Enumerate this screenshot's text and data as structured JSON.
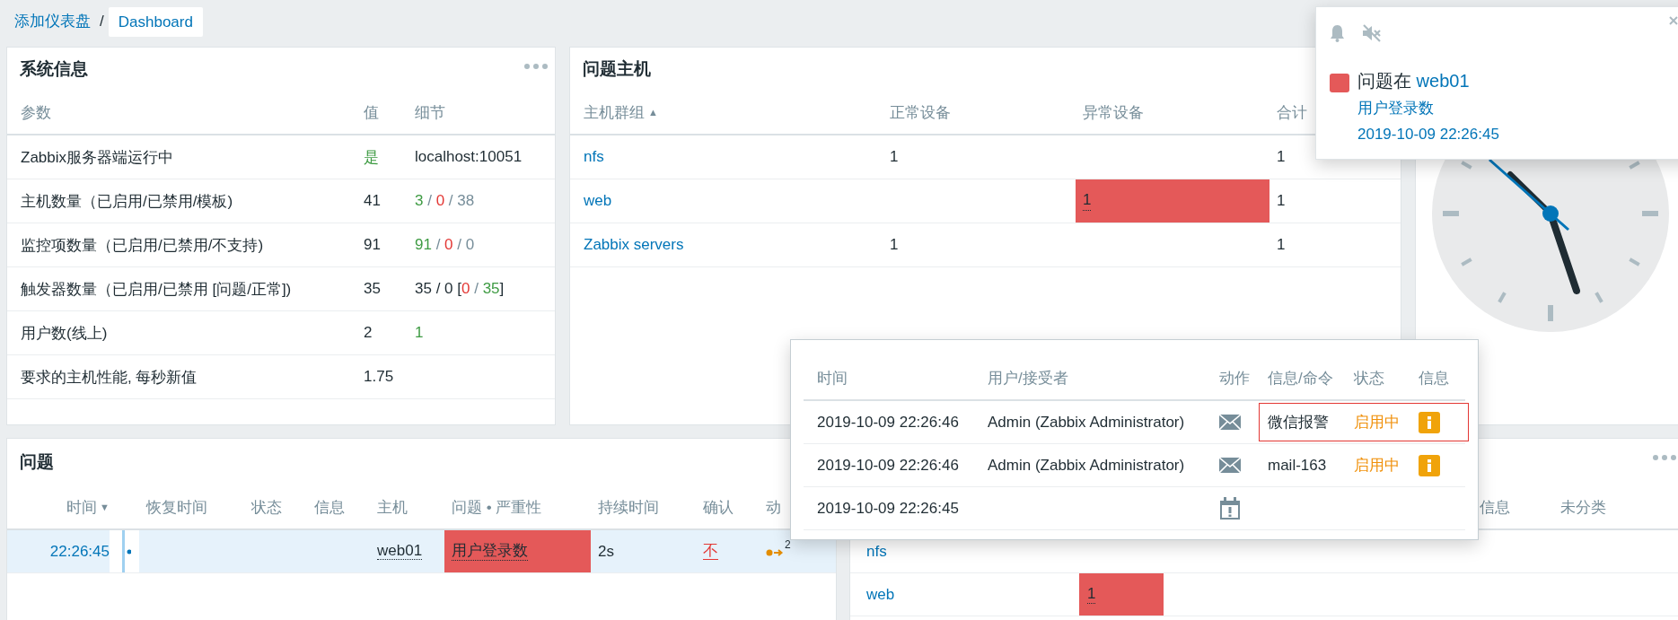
{
  "breadcrumb": {
    "parent": "添加仪表盘",
    "separator": "/",
    "current": "Dashboard"
  },
  "system_info": {
    "title": "系统信息",
    "columns": [
      "参数",
      "值",
      "细节"
    ],
    "rows": [
      {
        "parameter": "Zabbix服务器端运行中",
        "value": {
          "text": "是",
          "kind": "ok"
        },
        "details": [
          {
            "text": "localhost:10051",
            "kind": "plain"
          }
        ]
      },
      {
        "parameter": "主机数量（已启用/已禁用/模板)",
        "value": {
          "text": "41",
          "kind": "plain"
        },
        "details": [
          {
            "text": "3",
            "kind": "ok"
          },
          {
            "text": " / ",
            "kind": "muted"
          },
          {
            "text": "0",
            "kind": "bad"
          },
          {
            "text": " / ",
            "kind": "muted"
          },
          {
            "text": "38",
            "kind": "muted"
          }
        ]
      },
      {
        "parameter": "监控项数量（已启用/已禁用/不支持)",
        "value": {
          "text": "91",
          "kind": "plain"
        },
        "details": [
          {
            "text": "91",
            "kind": "ok"
          },
          {
            "text": " / ",
            "kind": "muted"
          },
          {
            "text": "0",
            "kind": "bad"
          },
          {
            "text": " / ",
            "kind": "muted"
          },
          {
            "text": "0",
            "kind": "muted"
          }
        ]
      },
      {
        "parameter": "触发器数量（已启用/已禁用 [问题/正常])",
        "value": {
          "text": "35",
          "kind": "plain"
        },
        "details": [
          {
            "text": "35 / 0 [",
            "kind": "plain"
          },
          {
            "text": "0",
            "kind": "bad"
          },
          {
            "text": " / ",
            "kind": "muted"
          },
          {
            "text": "35",
            "kind": "ok"
          },
          {
            "text": "]",
            "kind": "plain"
          }
        ]
      },
      {
        "parameter": "用户数(线上)",
        "value": {
          "text": "2",
          "kind": "plain"
        },
        "details": [
          {
            "text": "1",
            "kind": "ok"
          }
        ]
      },
      {
        "parameter": "要求的主机性能, 每秒新值",
        "value": {
          "text": "1.75",
          "kind": "plain"
        }
      }
    ]
  },
  "problem_hosts": {
    "title": "问题主机",
    "columns": [
      {
        "label": "主机群组",
        "sort_indicator": "▲"
      },
      {
        "label": "正常设备"
      },
      {
        "label": "异常设备"
      },
      {
        "label": "合计"
      }
    ],
    "rows": [
      {
        "group": "nfs",
        "ok": "1",
        "total": "1"
      },
      {
        "group": "web",
        "problem": {
          "text": "1",
          "color": "#e45959"
        },
        "total": "1"
      },
      {
        "group": "Zabbix servers",
        "ok": "1",
        "total": "1"
      }
    ]
  },
  "problems": {
    "title": "问题",
    "columns": [
      {
        "label": "时间",
        "sort_indicator": "▼"
      },
      {
        "label": "恢复时间"
      },
      {
        "label": "状态"
      },
      {
        "label": "信息"
      },
      {
        "label": "主机"
      },
      {
        "label": "问题 • 严重性"
      },
      {
        "label": "持续时间"
      },
      {
        "label": "确认"
      },
      {
        "label": "动"
      }
    ],
    "rows": [
      {
        "time": "22:26:45",
        "host": "web01",
        "problem": "用户登录数",
        "color": "#e45959",
        "duration": "2s",
        "ack": "不",
        "acknowledged": false,
        "actions_count": "2"
      }
    ]
  },
  "severity_widget": {
    "columns": [
      "信息",
      "未分类"
    ],
    "rows": [
      {
        "group": "nfs"
      },
      {
        "group": "web",
        "count": {
          "text": "1",
          "color": "#e45959"
        }
      }
    ]
  },
  "notification": {
    "color": "#e45959",
    "title": "问题在",
    "host": "web01",
    "problem": "用户登录数",
    "time": "2019-10-09 22:26:45"
  },
  "action_log": {
    "columns": [
      "时间",
      "用户/接受者",
      "动作",
      "信息/命令",
      "状态",
      "信息"
    ],
    "rows": [
      {
        "time": "2019-10-09 22:26:46",
        "user": "Admin (Zabbix Administrator)",
        "kind": "message",
        "message": "微信报警",
        "status": "启用中",
        "info": true,
        "highlighted": true
      },
      {
        "time": "2019-10-09 22:26:46",
        "user": "Admin (Zabbix Administrator)",
        "kind": "message",
        "message": "mail-163",
        "status": "启用中",
        "info": true,
        "highlighted": false
      },
      {
        "time": "2019-10-09 22:26:45",
        "kind": "event",
        "highlighted": false
      }
    ]
  }
}
